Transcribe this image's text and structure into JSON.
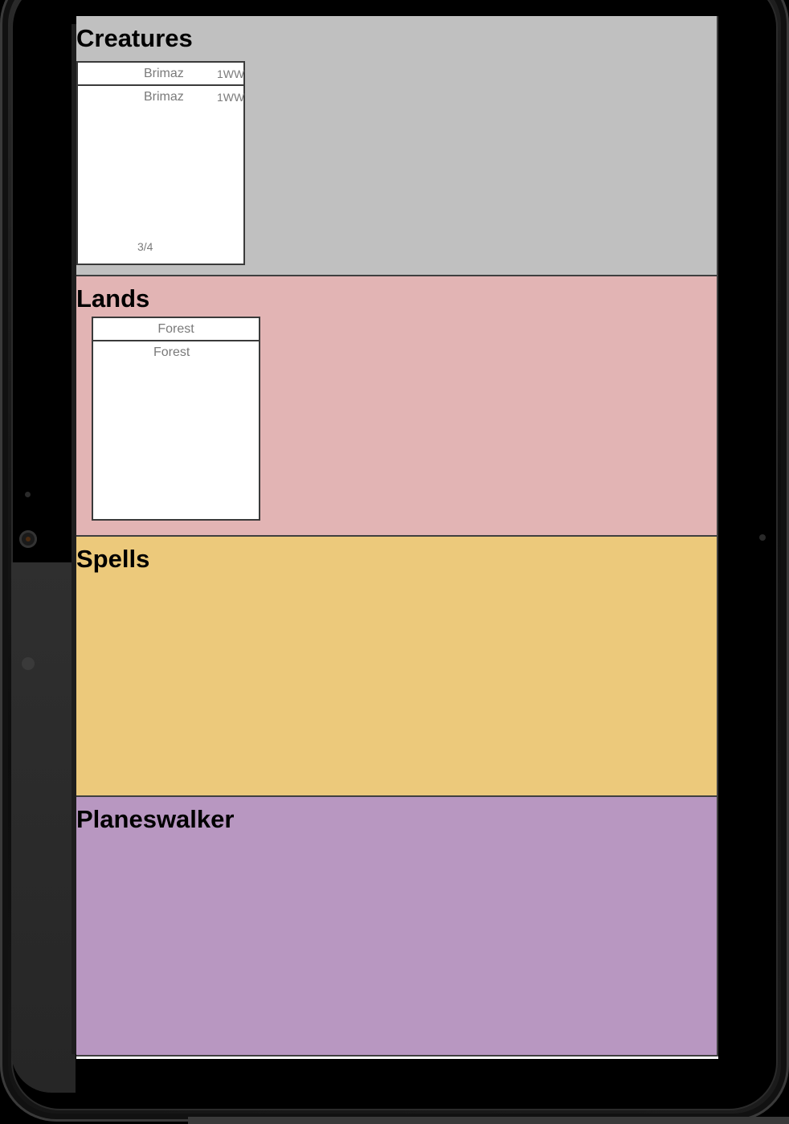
{
  "board": {
    "sections": [
      {
        "title": "Creatures",
        "cards": [
          {
            "header_name": "Brimaz",
            "header_cost": "1WW",
            "name": "Brimaz",
            "cost": "1WW",
            "stats": "3/4"
          }
        ]
      },
      {
        "title": "Lands",
        "cards": [
          {
            "header_name": "Forest",
            "name": "Forest"
          }
        ]
      },
      {
        "title": "Spells",
        "cards": []
      },
      {
        "title": "Planeswalker",
        "cards": []
      }
    ]
  }
}
